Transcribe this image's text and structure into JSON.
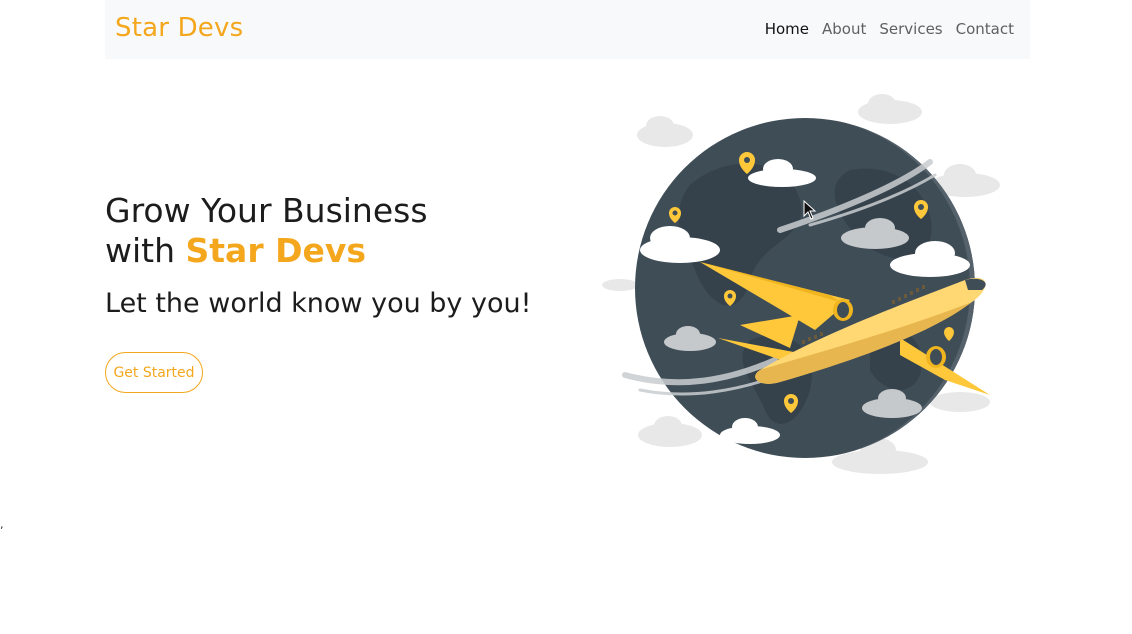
{
  "navbar": {
    "brand": "Star Devs",
    "links": [
      {
        "label": "Home",
        "active": true
      },
      {
        "label": "About",
        "active": false
      },
      {
        "label": "Services",
        "active": false
      },
      {
        "label": "Contact",
        "active": false
      }
    ]
  },
  "hero": {
    "title_line1": "Grow Your Business",
    "title_line2_prefix": "with",
    "title_brand": "Star Devs",
    "subtitle": "Let the world know you by you!",
    "cta_label": "Get Started"
  },
  "stray_mark": ",",
  "colors": {
    "accent": "#f4a71d",
    "navbar_bg": "#f8f9fa",
    "globe": "#3f4d57",
    "plane": "#ffc83a"
  },
  "icons": [
    "globe-airplane-illustration",
    "location-pin-icon",
    "cloud-icon",
    "cursor-pointer-icon"
  ]
}
